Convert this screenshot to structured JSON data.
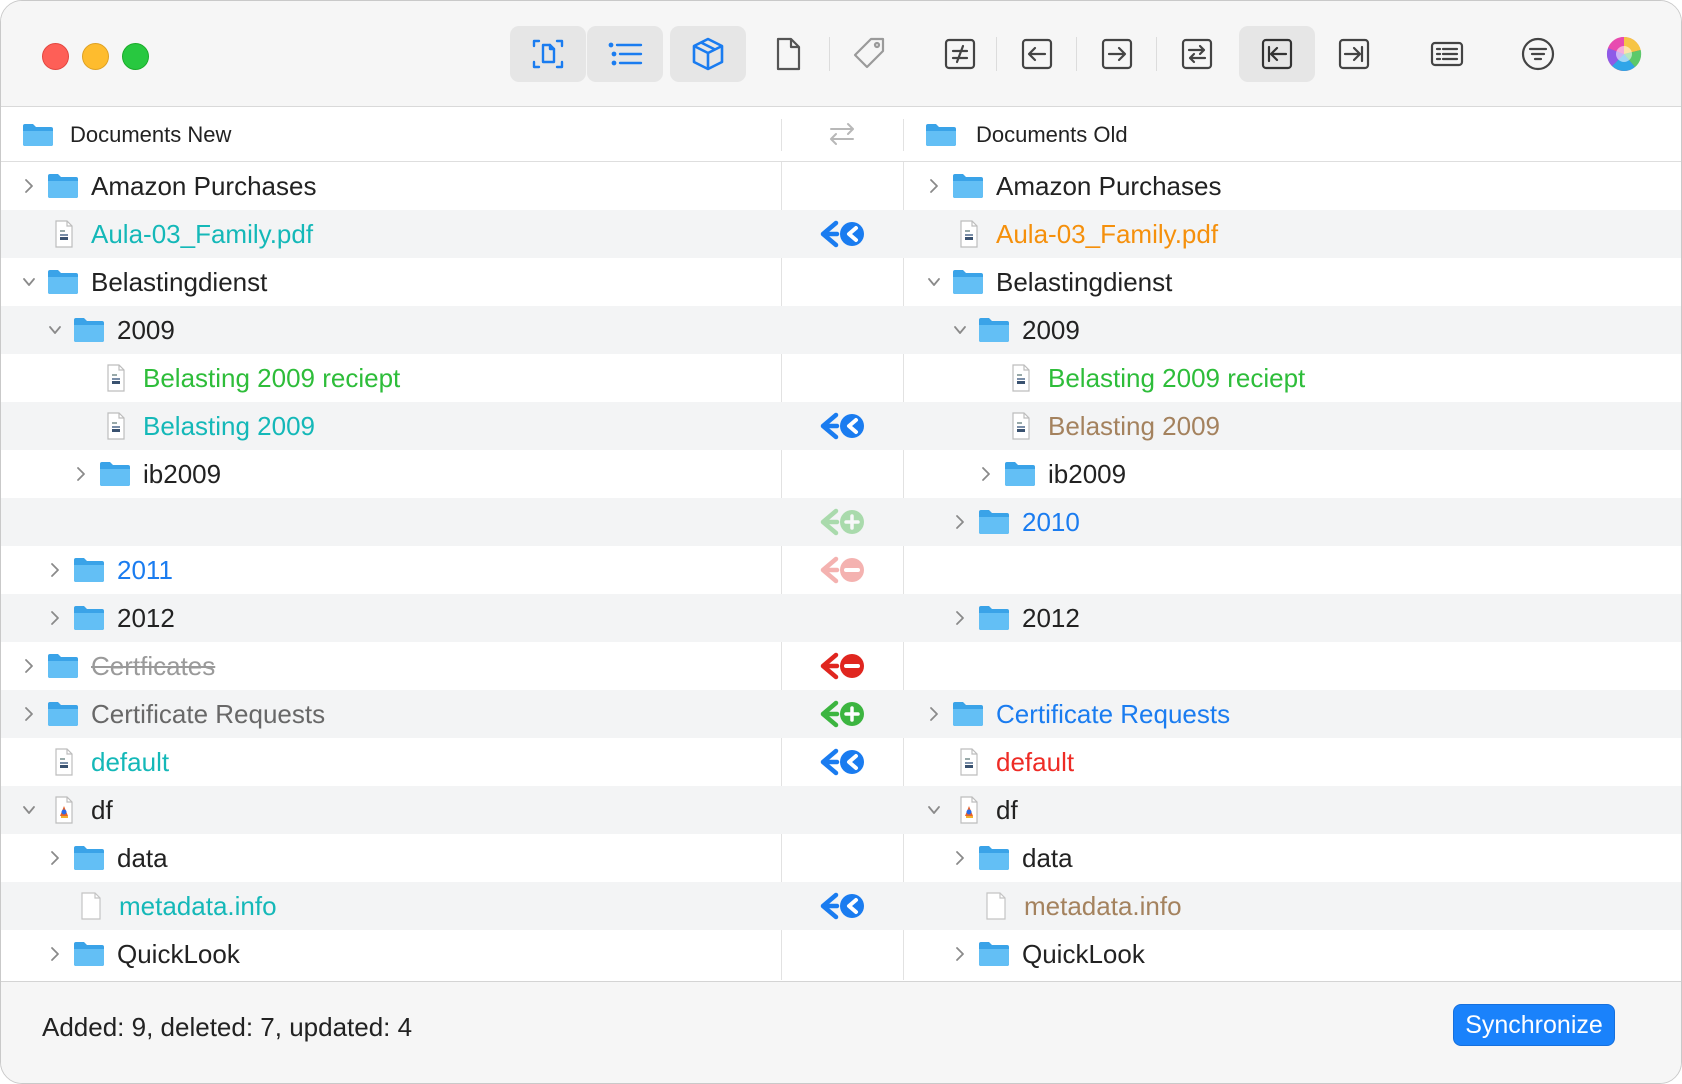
{
  "toolbar": {
    "buttons": [
      {
        "name": "compare-content-button",
        "icon": "doc-scan-icon",
        "active": true
      },
      {
        "name": "list-view-button",
        "icon": "list-icon",
        "active": true
      },
      {
        "name": "package-button",
        "icon": "box-icon",
        "active": true
      },
      {
        "name": "file-button",
        "icon": "document-icon",
        "active": false
      },
      {
        "name": "tag-button",
        "icon": "tag-icon",
        "active": false
      },
      {
        "name": "show-different-button",
        "icon": "not-equal-icon",
        "active": false
      },
      {
        "name": "copy-left-button",
        "icon": "arrow-left-box-icon",
        "active": false
      },
      {
        "name": "copy-right-button",
        "icon": "arrow-right-box-icon",
        "active": false
      },
      {
        "name": "swap-button",
        "icon": "swap-box-icon",
        "active": false
      },
      {
        "name": "sync-to-left-button",
        "icon": "arrow-to-left-bar-icon",
        "active": true
      },
      {
        "name": "sync-to-right-button",
        "icon": "arrow-to-right-bar-icon",
        "active": false
      },
      {
        "name": "details-button",
        "icon": "details-list-icon",
        "active": false
      },
      {
        "name": "filter-button",
        "icon": "filter-circle-icon",
        "active": false
      },
      {
        "name": "color-button",
        "icon": "color-wheel-icon",
        "active": false
      }
    ]
  },
  "header": {
    "left_title": "Documents New",
    "right_title": "Documents Old"
  },
  "colors": {
    "black": "#222222",
    "teal": "#14b8b8",
    "orange": "#f5900c",
    "green": "#2ebd3a",
    "brown": "#a4825e",
    "blue": "#1a7cf0",
    "red": "#ee2b25",
    "gray": "#686868",
    "strike": "#9a9a9a"
  },
  "rows": [
    {
      "left": {
        "name": "Amazon Purchases",
        "type": "folder",
        "color": "black",
        "indent": 0,
        "chevron": "right"
      },
      "action": "",
      "right": {
        "name": "Amazon Purchases",
        "type": "folder",
        "color": "black",
        "indent": 0,
        "chevron": "right"
      }
    },
    {
      "left": {
        "name": "Aula-03_Family.pdf",
        "type": "doc",
        "color": "teal",
        "indent": 0,
        "chevron": "none"
      },
      "action": "update",
      "right": {
        "name": "Aula-03_Family.pdf",
        "type": "doc",
        "color": "orange",
        "indent": 0,
        "chevron": "none"
      }
    },
    {
      "left": {
        "name": "Belastingdienst",
        "type": "folder",
        "color": "black",
        "indent": 0,
        "chevron": "down"
      },
      "action": "",
      "right": {
        "name": "Belastingdienst",
        "type": "folder",
        "color": "black",
        "indent": 0,
        "chevron": "down"
      }
    },
    {
      "left": {
        "name": "2009",
        "type": "folder",
        "color": "black",
        "indent": 1,
        "chevron": "down"
      },
      "action": "",
      "right": {
        "name": "2009",
        "type": "folder",
        "color": "black",
        "indent": 1,
        "chevron": "down"
      }
    },
    {
      "left": {
        "name": "Belasting 2009 reciept",
        "type": "doc",
        "color": "green",
        "indent": 2,
        "chevron": "none"
      },
      "action": "",
      "right": {
        "name": "Belasting 2009 reciept",
        "type": "doc",
        "color": "green",
        "indent": 2,
        "chevron": "none"
      }
    },
    {
      "left": {
        "name": "Belasting 2009",
        "type": "doc",
        "color": "teal",
        "indent": 2,
        "chevron": "none"
      },
      "action": "update",
      "right": {
        "name": "Belasting 2009",
        "type": "doc",
        "color": "brown",
        "indent": 2,
        "chevron": "none"
      }
    },
    {
      "left": {
        "name": "ib2009",
        "type": "folder",
        "color": "black",
        "indent": 2,
        "chevron": "right"
      },
      "action": "",
      "right": {
        "name": "ib2009",
        "type": "folder",
        "color": "black",
        "indent": 2,
        "chevron": "right"
      }
    },
    {
      "left": null,
      "action": "add-faded",
      "right": {
        "name": "2010",
        "type": "folder",
        "color": "blue",
        "indent": 1,
        "chevron": "right"
      }
    },
    {
      "left": {
        "name": "2011",
        "type": "folder",
        "color": "blue",
        "indent": 1,
        "chevron": "right"
      },
      "action": "delete-faded",
      "right": null
    },
    {
      "left": {
        "name": "2012",
        "type": "folder",
        "color": "black",
        "indent": 1,
        "chevron": "right"
      },
      "action": "",
      "right": {
        "name": "2012",
        "type": "folder",
        "color": "black",
        "indent": 1,
        "chevron": "right"
      }
    },
    {
      "left": {
        "name": "Certficates",
        "type": "folder",
        "color": "strike",
        "indent": 0,
        "chevron": "right",
        "strike": true
      },
      "action": "delete",
      "right": null
    },
    {
      "left": {
        "name": "Certificate Requests",
        "type": "folder",
        "color": "gray",
        "indent": 0,
        "chevron": "right"
      },
      "action": "add",
      "right": {
        "name": "Certificate Requests",
        "type": "folder",
        "color": "blue",
        "indent": 0,
        "chevron": "right"
      }
    },
    {
      "left": {
        "name": "default",
        "type": "doc",
        "color": "teal",
        "indent": 0,
        "chevron": "none"
      },
      "action": "update",
      "right": {
        "name": "default",
        "type": "doc",
        "color": "red",
        "indent": 0,
        "chevron": "none"
      }
    },
    {
      "left": {
        "name": "df",
        "type": "pkg",
        "color": "black",
        "indent": 0,
        "chevron": "down"
      },
      "action": "",
      "right": {
        "name": "df",
        "type": "pkg",
        "color": "black",
        "indent": 0,
        "chevron": "down"
      }
    },
    {
      "left": {
        "name": "data",
        "type": "folder",
        "color": "black",
        "indent": 1,
        "chevron": "right"
      },
      "action": "",
      "right": {
        "name": "data",
        "type": "folder",
        "color": "black",
        "indent": 1,
        "chevron": "right"
      }
    },
    {
      "left": {
        "name": "metadata.info",
        "type": "blank",
        "color": "teal",
        "indent": 1,
        "chevron": "none"
      },
      "action": "update",
      "right": {
        "name": "metadata.info",
        "type": "blank",
        "color": "brown",
        "indent": 1,
        "chevron": "none"
      }
    },
    {
      "left": {
        "name": "QuickLook",
        "type": "folder",
        "color": "black",
        "indent": 1,
        "chevron": "right"
      },
      "action": "",
      "right": {
        "name": "QuickLook",
        "type": "folder",
        "color": "black",
        "indent": 1,
        "chevron": "right"
      }
    }
  ],
  "footer": {
    "status": "Added: 9, deleted: 7, updated: 4",
    "sync_label": "Synchronize"
  }
}
